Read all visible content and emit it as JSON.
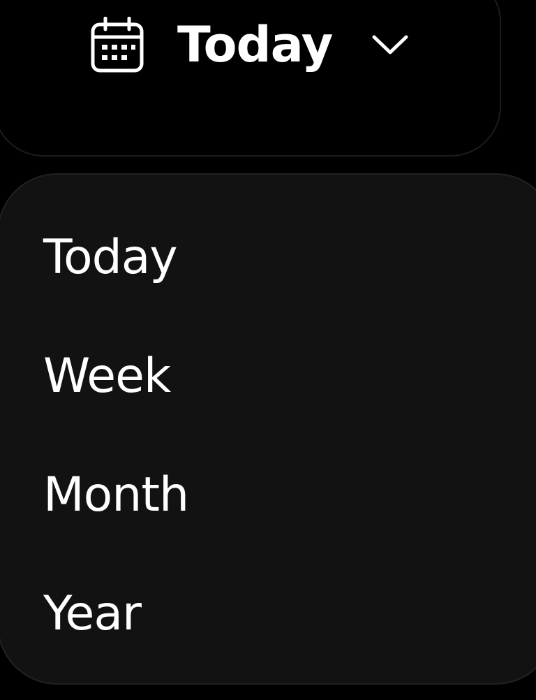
{
  "date_range_selector": {
    "selected_label": "Today",
    "icon": "calendar-icon",
    "dropdown_icon": "chevron-down-icon"
  },
  "dropdown": {
    "options": [
      "Today",
      "Week",
      "Month",
      "Year"
    ]
  },
  "colors": {
    "page_background": "#000000",
    "button_border": "#1c1c1c",
    "menu_background": "#121212",
    "menu_border": "#222222",
    "text": "#ffffff"
  }
}
